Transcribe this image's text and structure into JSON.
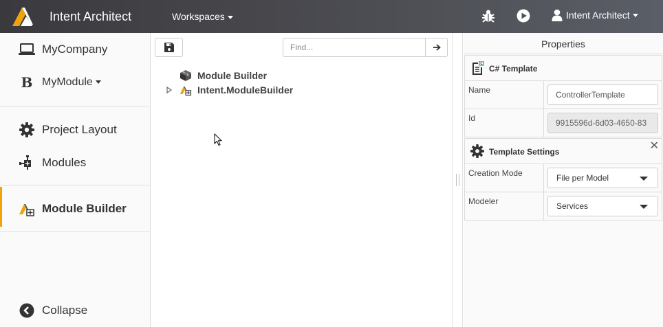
{
  "header": {
    "app_title": "Intent Architect",
    "workspaces_label": "Workspaces",
    "user_label": "Intent Architect",
    "icons": {
      "logo": "intent-architect-logo",
      "debug": "bug-icon",
      "run": "play-icon",
      "user": "user-icon"
    },
    "colors": {
      "logo_orange": "#f0a30a",
      "logo_white": "#ffffff"
    }
  },
  "sidebar": {
    "items": [
      {
        "label": "MyCompany",
        "icon": "laptop-icon"
      },
      {
        "label": "MyModule",
        "icon": "b-module-icon"
      },
      {
        "label": "Project Layout",
        "icon": "gear-icon"
      },
      {
        "label": "Modules",
        "icon": "modules-icon"
      },
      {
        "label": "Module Builder",
        "icon": "module-builder-icon",
        "active": true
      },
      {
        "label": "Collapse",
        "icon": "chevron-left-icon"
      }
    ],
    "accent_color": "#f0a30a"
  },
  "center": {
    "search": {
      "placeholder": "Find...",
      "value": ""
    },
    "tree": [
      {
        "label": "Module Builder",
        "icon": "package-icon",
        "expandable": false
      },
      {
        "label": "Intent.ModuleBuilder",
        "icon": "module-builder-icon",
        "expandable": true
      }
    ]
  },
  "properties": {
    "title": "Properties",
    "sections": [
      {
        "title": "C# Template",
        "icon": "template-file-icon",
        "rows": [
          {
            "name": "Name",
            "value": "ControllerTemplate",
            "readonly": false
          },
          {
            "name": "Id",
            "value": "9915596d-6d03-4650-83",
            "readonly": true
          }
        ]
      },
      {
        "title": "Template Settings",
        "icon": "gear-icon",
        "closable": true,
        "close_label": "✕",
        "rows": [
          {
            "name": "Creation Mode",
            "value": "File per Model",
            "type": "select"
          },
          {
            "name": "Modeler",
            "value": "Services",
            "type": "select"
          }
        ]
      }
    ]
  }
}
